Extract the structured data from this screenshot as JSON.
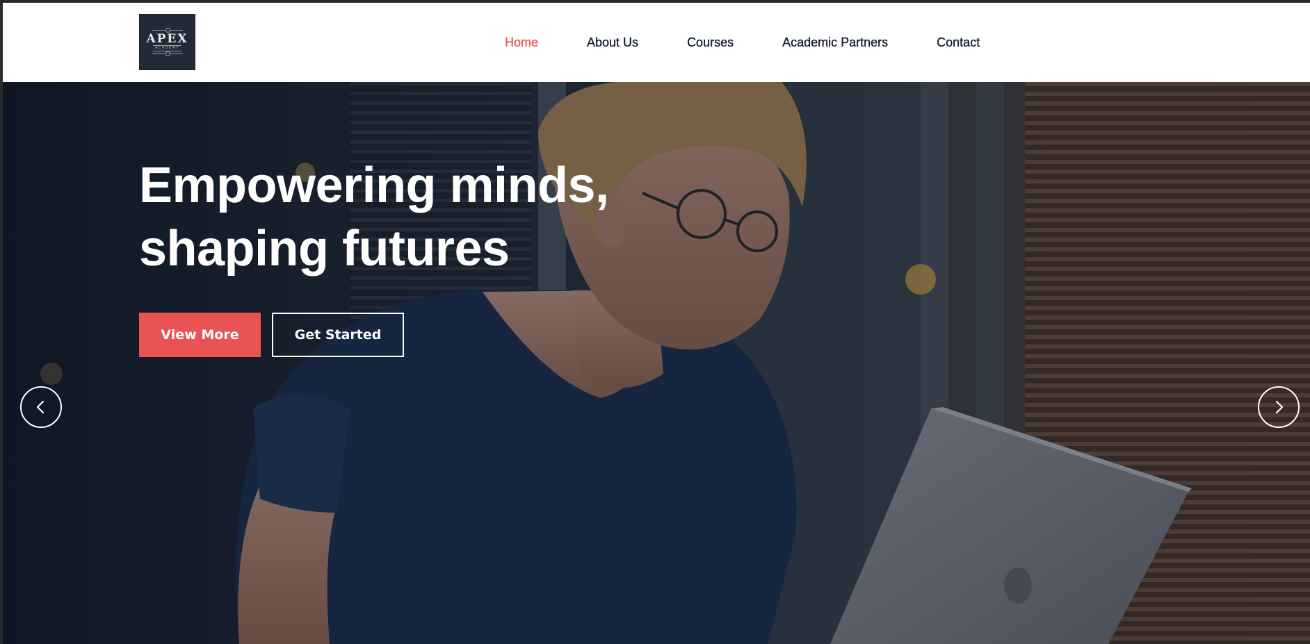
{
  "brand": {
    "logo_main": "APEX",
    "logo_sub": "ACADEMY"
  },
  "nav": {
    "items": [
      {
        "label": "Home",
        "active": true
      },
      {
        "label": "About Us",
        "active": false
      },
      {
        "label": "Courses",
        "active": false
      },
      {
        "label": "Academic Partners",
        "active": false
      },
      {
        "label": "Contact",
        "active": false
      }
    ]
  },
  "hero": {
    "title_line1": "Empowering minds,",
    "title_line2": "shaping futures",
    "primary_button": "View More",
    "secondary_button": "Get Started",
    "prev_icon": "chevron-left-icon",
    "next_icon": "chevron-right-icon"
  },
  "colors": {
    "accent": "#ea5353",
    "nav_text": "#0f1a2c",
    "header_bg": "#ffffff"
  }
}
